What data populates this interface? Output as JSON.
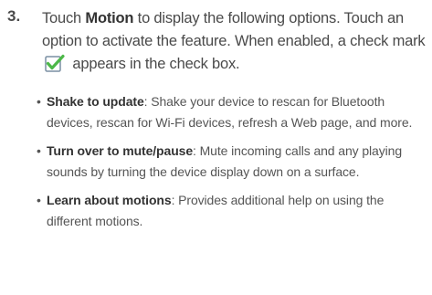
{
  "step": {
    "number": "3.",
    "text_touch": "Touch ",
    "text_motion": "Motion",
    "text_mid": " to display the following options. Touch an option to activate the feature. When enabled, a check mark",
    "text_end": "appears in the check box.",
    "checkmark_icon": "green-checkmark-icon",
    "checkmark_colors": {
      "box": "#ffffff",
      "border": "#7a8fa3",
      "check": "#4db849"
    }
  },
  "bullets": [
    {
      "title": "Shake to update",
      "text": ": Shake your device to rescan for Bluetooth devices, rescan for Wi-Fi devices, refresh a Web page, and more."
    },
    {
      "title": "Turn over to mute/pause",
      "text": ": Mute incoming calls and any playing sounds by turning the device display down on a surface."
    },
    {
      "title": "Learn about motions",
      "text": ": Provides additional help on using the different motions."
    }
  ],
  "bullet_symbol": "•"
}
